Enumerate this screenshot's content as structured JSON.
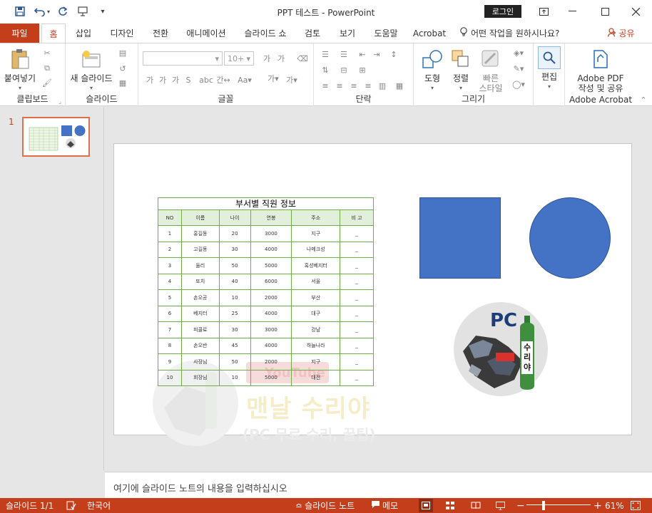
{
  "window": {
    "title": "PPT 테스트  -  PowerPoint",
    "login_label": "로그인"
  },
  "tabs": [
    "파일",
    "홈",
    "삽입",
    "디자인",
    "전환",
    "애니메이션",
    "슬라이드 쇼",
    "검토",
    "보기",
    "도움말",
    "Acrobat"
  ],
  "tell_me": "어떤 작업을 원하시나요?",
  "share_label": "공유",
  "ribbon": {
    "clipboard": {
      "paste": "붙여넣기",
      "group": "클립보드"
    },
    "slides": {
      "new_slide": "새 슬라이드",
      "group": "슬라이드"
    },
    "font": {
      "size": "10+",
      "group": "글꼴"
    },
    "paragraph": {
      "group": "단락"
    },
    "drawing": {
      "shapes": "도형",
      "arrange": "정렬",
      "quick_styles_1": "빠른",
      "quick_styles_2": "스타일",
      "group": "그리기"
    },
    "editing": {
      "label": "편집"
    },
    "acrobat": {
      "line1": "Adobe PDF",
      "line2": "작성 및 공유",
      "group": "Adobe Acrobat"
    }
  },
  "thumbnail": {
    "number": "1"
  },
  "slide": {
    "table": {
      "title": "부서별 직원 정보",
      "headers": [
        "NO",
        "이름",
        "나이",
        "연봉",
        "주소",
        "비 고"
      ],
      "rows": [
        [
          "1",
          "홍길동",
          "20",
          "3000",
          "지구",
          "_"
        ],
        [
          "2",
          "고길동",
          "30",
          "4000",
          "나메크성",
          "_"
        ],
        [
          "3",
          "둘리",
          "50",
          "5000",
          "혹성베지터",
          "_"
        ],
        [
          "4",
          "또치",
          "40",
          "6000",
          "서울",
          "_"
        ],
        [
          "5",
          "손오공",
          "10",
          "2000",
          "부산",
          "_"
        ],
        [
          "6",
          "베지터",
          "25",
          "4000",
          "대구",
          "_"
        ],
        [
          "7",
          "피콜로",
          "30",
          "3000",
          "강남",
          "_"
        ],
        [
          "8",
          "손오반",
          "45",
          "4000",
          "하늘나라",
          "_"
        ],
        [
          "9",
          "사장님",
          "50",
          "2000",
          "지구",
          "_"
        ],
        [
          "10",
          "회장님",
          "10",
          "5000",
          "대전",
          "_"
        ]
      ]
    },
    "logo_text": "PC",
    "logo_bottle_text": "수리야",
    "watermark": {
      "youtube": "YouTube",
      "channel": "맨날 수리야",
      "subtitle": "(PC 무료 수리, 꿀팁)"
    },
    "shape_color": "#4472c4"
  },
  "notes_placeholder": "여기에 슬라이드 노트의 내용을 입력하십시오",
  "status": {
    "slide_count": "슬라이드 1/1",
    "language": "한국어",
    "notes_label": "슬라이드 노트",
    "comments_label": "메모",
    "zoom": "61%"
  },
  "colors": {
    "accent": "#c43e1c",
    "table_border": "#70ad47",
    "shape_fill": "#4472c4"
  }
}
